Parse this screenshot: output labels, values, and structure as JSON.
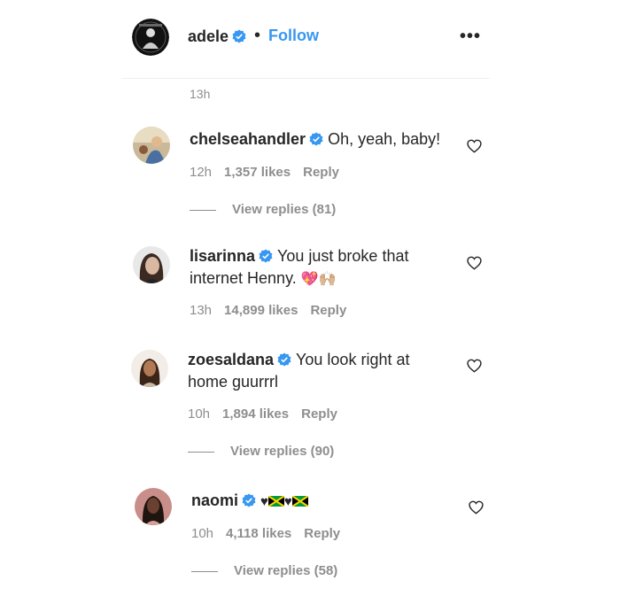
{
  "header": {
    "username": "adele",
    "separator": "•",
    "follow_label": "Follow",
    "more_icon": "•••"
  },
  "caption": {
    "time": "13h"
  },
  "comments": [
    {
      "username": "chelseahandler",
      "text": "Oh, yeah, baby!",
      "time": "12h",
      "likes": "1,357 likes",
      "reply": "Reply",
      "view_replies": "View replies (81)"
    },
    {
      "username": "lisarinna",
      "text": "You just broke that internet Henny.",
      "emoji": "💖🙌🏼",
      "time": "13h",
      "likes": "14,899 likes",
      "reply": "Reply"
    },
    {
      "username": "zoesaldana",
      "text": "You look right at home guurrrl",
      "time": "10h",
      "likes": "1,894 likes",
      "reply": "Reply",
      "view_replies": "View replies (90)"
    },
    {
      "username": "naomi",
      "text": "♥",
      "time": "10h",
      "likes": "4,118 likes",
      "reply": "Reply",
      "view_replies": "View replies (58)"
    }
  ],
  "colors": {
    "link": "#3897f0",
    "muted": "#8e8e8e",
    "text": "#262626",
    "verified": "#3897f0"
  }
}
